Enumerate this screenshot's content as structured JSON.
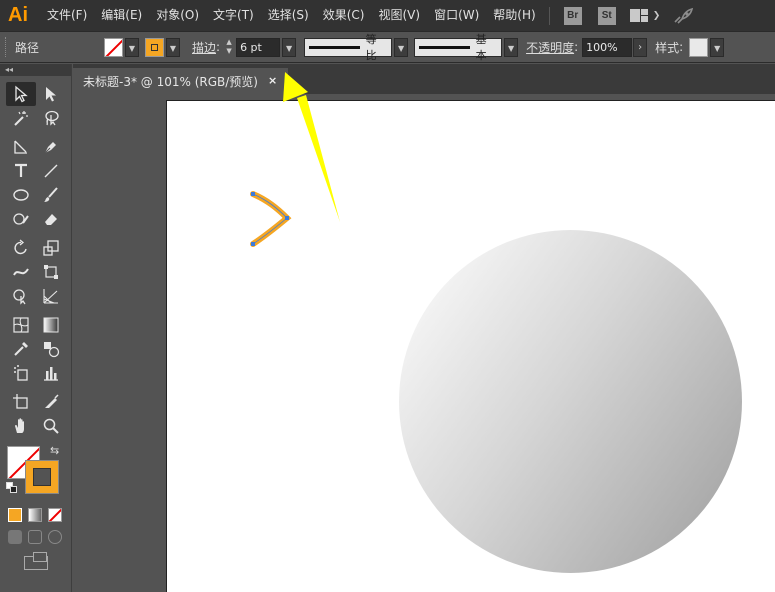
{
  "app": {
    "logo": "Ai",
    "menu": [
      "文件(F)",
      "编辑(E)",
      "对象(O)",
      "文字(T)",
      "选择(S)",
      "效果(C)",
      "视图(V)",
      "窗口(W)",
      "帮助(H)"
    ],
    "bridge_badge": "Br",
    "stock_badge": "St"
  },
  "control_bar": {
    "selection_type": "路径",
    "stroke_label": "描边",
    "stroke_weight": "6 pt",
    "variable_width_profile": "等比",
    "brush_definition": "基本",
    "opacity_label": "不透明度",
    "opacity_value": "100%",
    "style_label": "样式"
  },
  "document": {
    "tab_title": "未标题-3* @ 101% (RGB/预览)",
    "close_glyph": "×"
  },
  "colors": {
    "accent_stroke": "#f5a623",
    "annotation_arrow": "#ffff00",
    "anchor_points": "#3d7bd9"
  },
  "toolbar": {
    "tools": [
      [
        "selection-tool",
        "direct-selection-tool"
      ],
      [
        "magic-wand-tool",
        "lasso-tool"
      ],
      [
        "pen-tool",
        "curvature-tool"
      ],
      [
        "type-tool",
        "line-segment-tool"
      ],
      [
        "ellipse-tool",
        "paintbrush-tool"
      ],
      [
        "shaper-tool",
        "eraser-tool"
      ],
      [
        "rotate-tool",
        "scale-tool"
      ],
      [
        "width-tool",
        "free-transform-tool"
      ],
      [
        "shape-builder-tool",
        "perspective-grid-tool"
      ],
      [
        "mesh-tool",
        "gradient-tool"
      ],
      [
        "eyedropper-tool",
        "blend-tool"
      ],
      [
        "symbol-sprayer-tool",
        "column-graph-tool"
      ],
      [
        "artboard-tool",
        "slice-tool"
      ],
      [
        "hand-tool",
        "zoom-tool"
      ]
    ]
  }
}
